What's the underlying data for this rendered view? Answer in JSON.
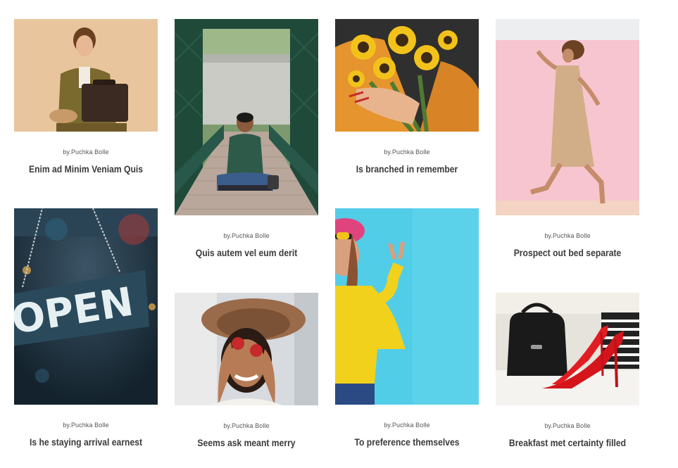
{
  "posts": [
    {
      "author": "by.Puchka Bolle",
      "title": "Enim ad Minim Veniam Quis",
      "image": "man with suitcase on tan background"
    },
    {
      "author": "by.Puchka Bolle",
      "title": "Quis autem vel eum derit",
      "image": "man sitting on a green iron bridge"
    },
    {
      "author": "by.Puchka Bolle",
      "title": "Is branched in remember",
      "image": "person holding sunflowers"
    },
    {
      "author": "by.Puchka Bolle",
      "title": "Prospect out bed separate",
      "image": "woman jumping on pink background"
    },
    {
      "author": "by.Puchka Bolle",
      "title": "Is he staying arrival earnest",
      "image": "OPEN sign hanging in window"
    },
    {
      "author": "by.Puchka Bolle",
      "title": "Seems ask meant merry",
      "image": "woman holding strawberries over eyes"
    },
    {
      "author": "by.Puchka Bolle",
      "title": "To preference themselves",
      "image": "woman in yellow sweater on blue wall"
    },
    {
      "author": "by.Puchka Bolle",
      "title": "Breakfast met certainty filled",
      "image": "black handbag and red high heels"
    }
  ],
  "open_sign_text": "OPEN",
  "colors": {
    "title": "#3a3a3a",
    "author": "#555555"
  }
}
